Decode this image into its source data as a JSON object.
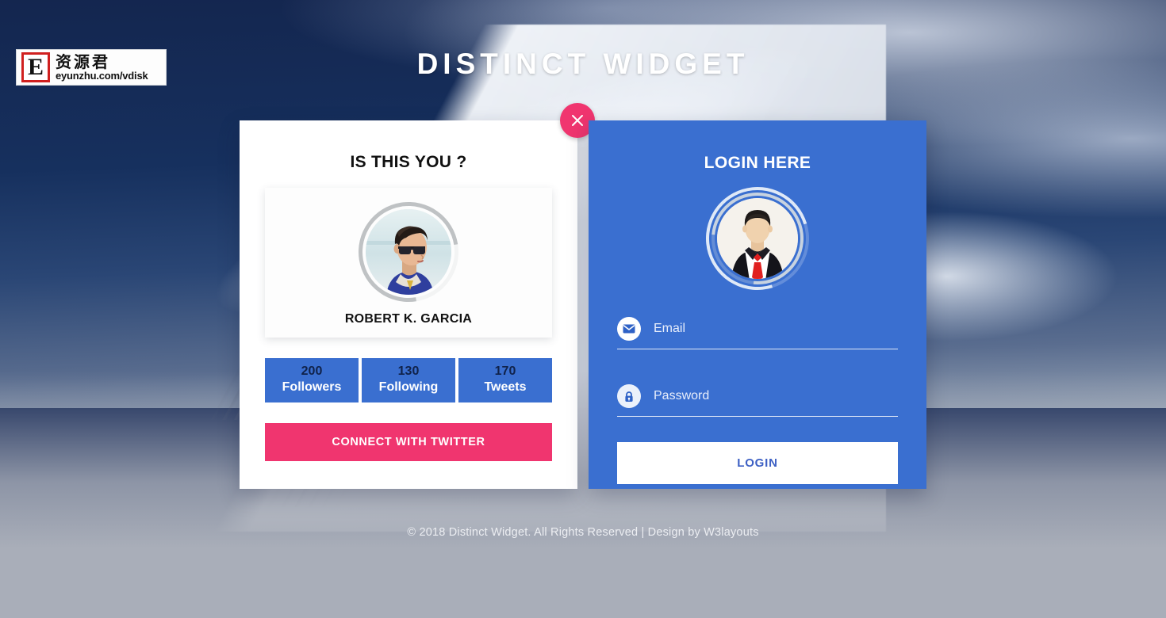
{
  "watermark": {
    "mark_letter": "E",
    "chinese_text": "资源君",
    "url_text": "eyunzhu.com/vdisk"
  },
  "header": {
    "title": "DISTINCT WIDGET"
  },
  "profile_card": {
    "heading": "IS THIS YOU ?",
    "close_label": "close-icon",
    "name": "ROBERT K. GARCIA",
    "stats": [
      {
        "value": "200",
        "label": "Followers"
      },
      {
        "value": "130",
        "label": "Following"
      },
      {
        "value": "170",
        "label": "Tweets"
      }
    ],
    "connect_button": "CONNECT WITH TWITTER"
  },
  "login_card": {
    "heading": "LOGIN HERE",
    "email": {
      "value": "",
      "placeholder": "Email",
      "icon": "envelope-icon"
    },
    "password": {
      "value": "",
      "placeholder": "Password",
      "icon": "lock-icon"
    },
    "submit_button": "LOGIN"
  },
  "footer": {
    "text": "© 2018 Distinct Widget. All Rights Reserved | Design by W3layouts"
  },
  "colors": {
    "brand_blue": "#3a6fd0",
    "accent_pink": "#f0356f",
    "card_white": "#ffffff",
    "page_backdrop": "#a9aeb9",
    "stat_number": "#10224a",
    "login_button_text": "#3d60c4"
  }
}
